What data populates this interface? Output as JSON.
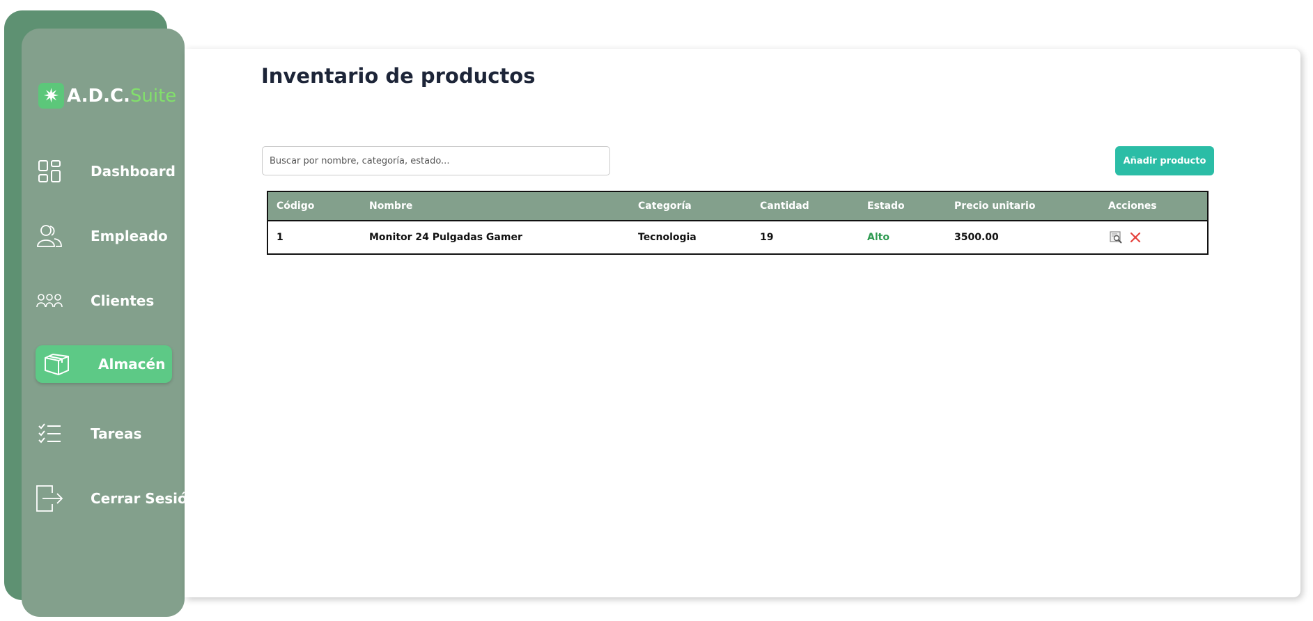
{
  "brand": {
    "name_main": "A.D.C.",
    "name_accent": "Suite",
    "colors": {
      "primary": "#83a08c",
      "back": "#5e9172",
      "active": "#5dc986",
      "accent": "#82e06b",
      "button": "#2bbda6",
      "status_high": "#2f9b52",
      "delete": "#e5413c"
    }
  },
  "sidebar": {
    "items": [
      {
        "label": "Dashboard",
        "icon": "dashboard-icon",
        "active": false
      },
      {
        "label": "Empleado",
        "icon": "employee-icon",
        "active": false
      },
      {
        "label": "Clientes",
        "icon": "clients-icon",
        "active": false
      },
      {
        "label": "Almacén",
        "icon": "warehouse-box-icon",
        "active": true
      },
      {
        "label": "Tareas",
        "icon": "tasks-checklist-icon",
        "active": false
      },
      {
        "label": "Cerrar Sesión",
        "icon": "logout-icon",
        "active": false
      }
    ]
  },
  "main": {
    "title": "Inventario de productos",
    "search": {
      "placeholder": "Buscar por nombre, categoría, estado...",
      "value": ""
    },
    "add_button": "Añadir producto",
    "table": {
      "headers": [
        "Código",
        "Nombre",
        "Categoría",
        "Cantidad",
        "Estado",
        "Precio unitario",
        "Acciones"
      ],
      "rows": [
        {
          "codigo": "1",
          "nombre": "Monitor 24 Pulgadas Gamer",
          "categoria": "Tecnologia",
          "cantidad": "19",
          "estado": "Alto",
          "precio": "3500.00",
          "actions": [
            "view-edit-icon",
            "delete-x-icon"
          ]
        }
      ]
    }
  }
}
